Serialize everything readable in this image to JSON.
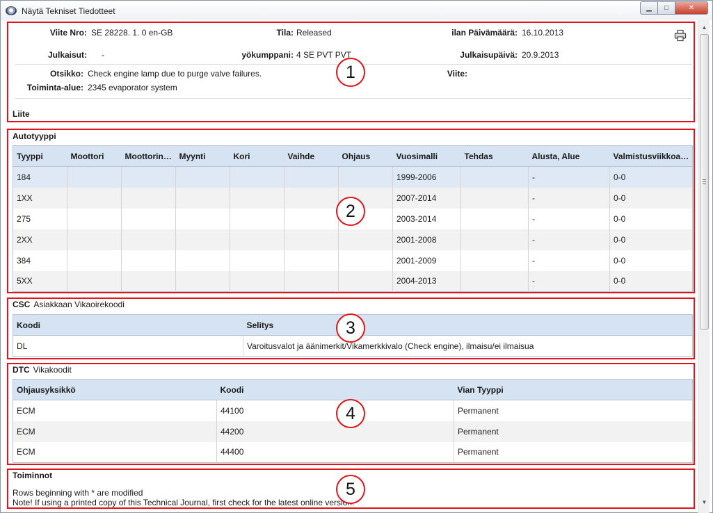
{
  "window": {
    "title": "Näytä Tekniset Tiedotteet",
    "minimize_glyph": "▁",
    "maximize_glyph": "□",
    "close_glyph": "✕"
  },
  "header": {
    "viite_nro_label": "Viite Nro:",
    "viite_nro_value": "SE 28228. 1. 0 en-GB",
    "tila_label": "Tila:",
    "tila_value": "Released",
    "paivamaara_label": "ilan Päivämäärä:",
    "paivamaara_value": "16.10.2013",
    "julkaisut_label": "Julkaisut:",
    "julkaisut_value": "-",
    "yokumppani_label": "yökumppani:",
    "yokumppani_value": "4 SE PVT PVT",
    "julkaisupaiva_label": "Julkaisupäivä:",
    "julkaisupaiva_value": "20.9.2013",
    "otsikko_label": "Otsikko:",
    "otsikko_value": "Check engine lamp due to purge valve failures.",
    "viite_label": "Viite:",
    "toiminta_alue_label": "Toiminta-alue:",
    "toiminta_alue_value": "2345 evaporator system",
    "liite_label": "Liite",
    "print_icon": "printer-icon"
  },
  "autotyyppi": {
    "title": "Autotyyppi",
    "columns": [
      "Tyyppi",
      "Moottori",
      "Moottorin…",
      "Myynti",
      "Kori",
      "Vaihde",
      "Ohjaus",
      "Vuosimalli",
      "Tehdas",
      "Alusta, Alue",
      "Valmistusviikkoa…"
    ],
    "rows": [
      [
        "184",
        "",
        "",
        "",
        "",
        "",
        "",
        "1999-2006",
        "",
        "-",
        "0-0"
      ],
      [
        "1XX",
        "",
        "",
        "",
        "",
        "",
        "",
        "2007-2014",
        "",
        "-",
        "0-0"
      ],
      [
        "275",
        "",
        "",
        "",
        "",
        "",
        "",
        "2003-2014",
        "",
        "-",
        "0-0"
      ],
      [
        "2XX",
        "",
        "",
        "",
        "",
        "",
        "",
        "2001-2008",
        "",
        "-",
        "0-0"
      ],
      [
        "384",
        "",
        "",
        "",
        "",
        "",
        "",
        "2001-2009",
        "",
        "-",
        "0-0"
      ],
      [
        "5XX",
        "",
        "",
        "",
        "",
        "",
        "",
        "2004-2013",
        "",
        "-",
        "0-0"
      ]
    ]
  },
  "csc": {
    "title": "CSC",
    "subtitle": "Asiakkaan Vikaoirekoodi",
    "columns": [
      "Koodi",
      "Selitys"
    ],
    "rows": [
      [
        "DL",
        "Varoitusvalot ja äänimerkit/Vikamerkkivalo (Check engine), ilmaisu/ei ilmaisua"
      ]
    ]
  },
  "dtc": {
    "title": "DTC",
    "subtitle": "Vikakoodit",
    "columns": [
      "Ohjausyksikkö",
      "Koodi",
      "Vian Tyyppi"
    ],
    "rows": [
      [
        "ECM",
        "44100",
        "Permanent"
      ],
      [
        "ECM",
        "44200",
        "Permanent"
      ],
      [
        "ECM",
        "44400",
        "Permanent"
      ]
    ]
  },
  "toiminnot": {
    "title": "Toiminnot",
    "line1": "Rows beginning with * are modified",
    "line2": "Note! If using a printed copy of this Technical Journal, first check for the latest online version."
  },
  "callouts": [
    "1",
    "2",
    "3",
    "4",
    "5"
  ],
  "colors": {
    "highlight": "#e0151b",
    "table_header": "#d6e3f3",
    "selected_row": "#dfe9f6"
  },
  "scrollbar": {
    "up_glyph": "▲",
    "down_glyph": "▼"
  }
}
